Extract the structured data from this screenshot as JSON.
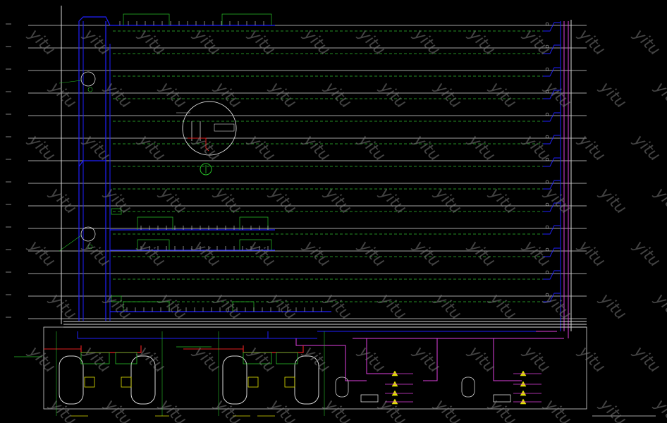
{
  "drawing": {
    "title_block_text": "",
    "watermark_text": "yitu",
    "colors": {
      "background": "#000000",
      "floor_line": "#d8d8d8",
      "green_dashed": "#2fbf2f",
      "blue_pipe": "#2020ff",
      "magenta_pipe": "#e040e0",
      "red_pipe": "#e02020",
      "green_box": "#28c028",
      "yellow": "#e0e000",
      "white": "#ffffff"
    }
  }
}
